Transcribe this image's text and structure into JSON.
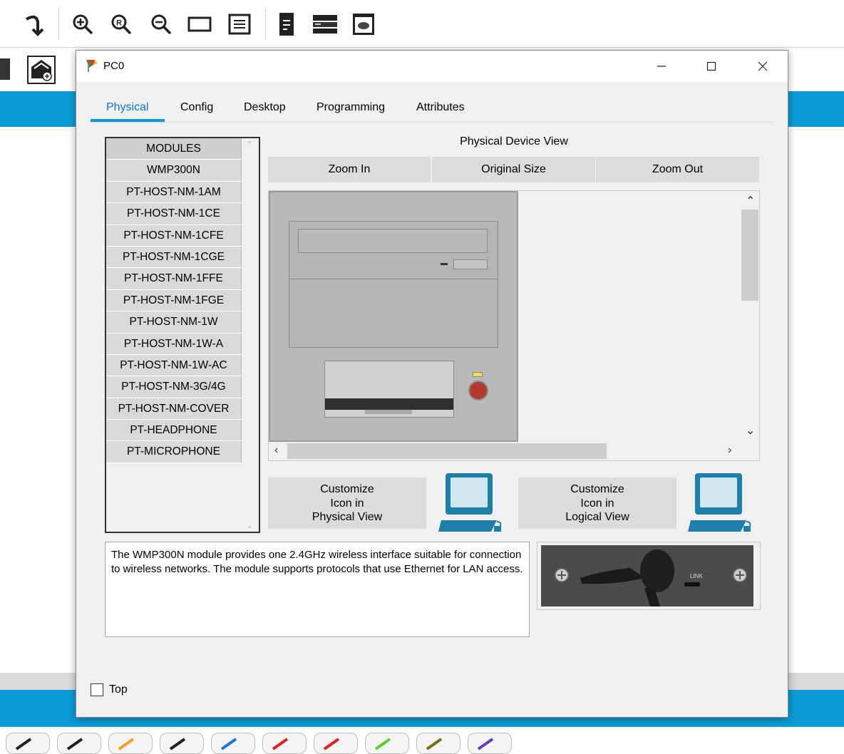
{
  "toolbar": {
    "icons": [
      "undo-arrow-icon",
      "zoom-in-icon",
      "zoom-reset-icon",
      "zoom-out-icon",
      "rectangle-icon",
      "list-view-icon",
      "document-icon",
      "device-rack-icon",
      "cloud-server-icon"
    ]
  },
  "dialog": {
    "title": "PC0",
    "tabs": [
      "Physical",
      "Config",
      "Desktop",
      "Programming",
      "Attributes"
    ],
    "active_tab": "Physical",
    "modules": {
      "header": "MODULES",
      "items": [
        "WMP300N",
        "PT-HOST-NM-1AM",
        "PT-HOST-NM-1CE",
        "PT-HOST-NM-1CFE",
        "PT-HOST-NM-1CGE",
        "PT-HOST-NM-1FFE",
        "PT-HOST-NM-1FGE",
        "PT-HOST-NM-1W",
        "PT-HOST-NM-1W-A",
        "PT-HOST-NM-1W-AC",
        "PT-HOST-NM-3G/4G",
        "PT-HOST-NM-COVER",
        "PT-HEADPHONE",
        "PT-MICROPHONE"
      ]
    },
    "physical_view": {
      "label": "Physical Device View",
      "zoom_in": "Zoom In",
      "original_size": "Original Size",
      "zoom_out": "Zoom Out",
      "led_color": "#e6e24a",
      "power_button_color": "#b23a2e"
    },
    "customize_physical": {
      "line1": "Customize",
      "line2": "Icon in",
      "line3": "Physical View"
    },
    "customize_logical": {
      "line1": "Customize",
      "line2": "Icon in",
      "line3": "Logical View"
    },
    "description": "The WMP300N module provides one 2.4GHz wireless interface suitable for connection to wireless networks. The module supports protocols that use Ethernet for LAN access.",
    "module_image": {
      "link_label": "LINK"
    },
    "top_checkbox": {
      "label": "Top",
      "checked": false
    }
  },
  "colors": {
    "accent_blue": "#0a9ad6",
    "active_tab_text": "#0a76c8"
  },
  "cable_colors": [
    "#222222",
    "#222222",
    "#f0a01e",
    "#222222",
    "#1e6fe0",
    "#e02020",
    "#e02020",
    "#5ad02a",
    "#7a6a10",
    "#6a3ab0"
  ]
}
